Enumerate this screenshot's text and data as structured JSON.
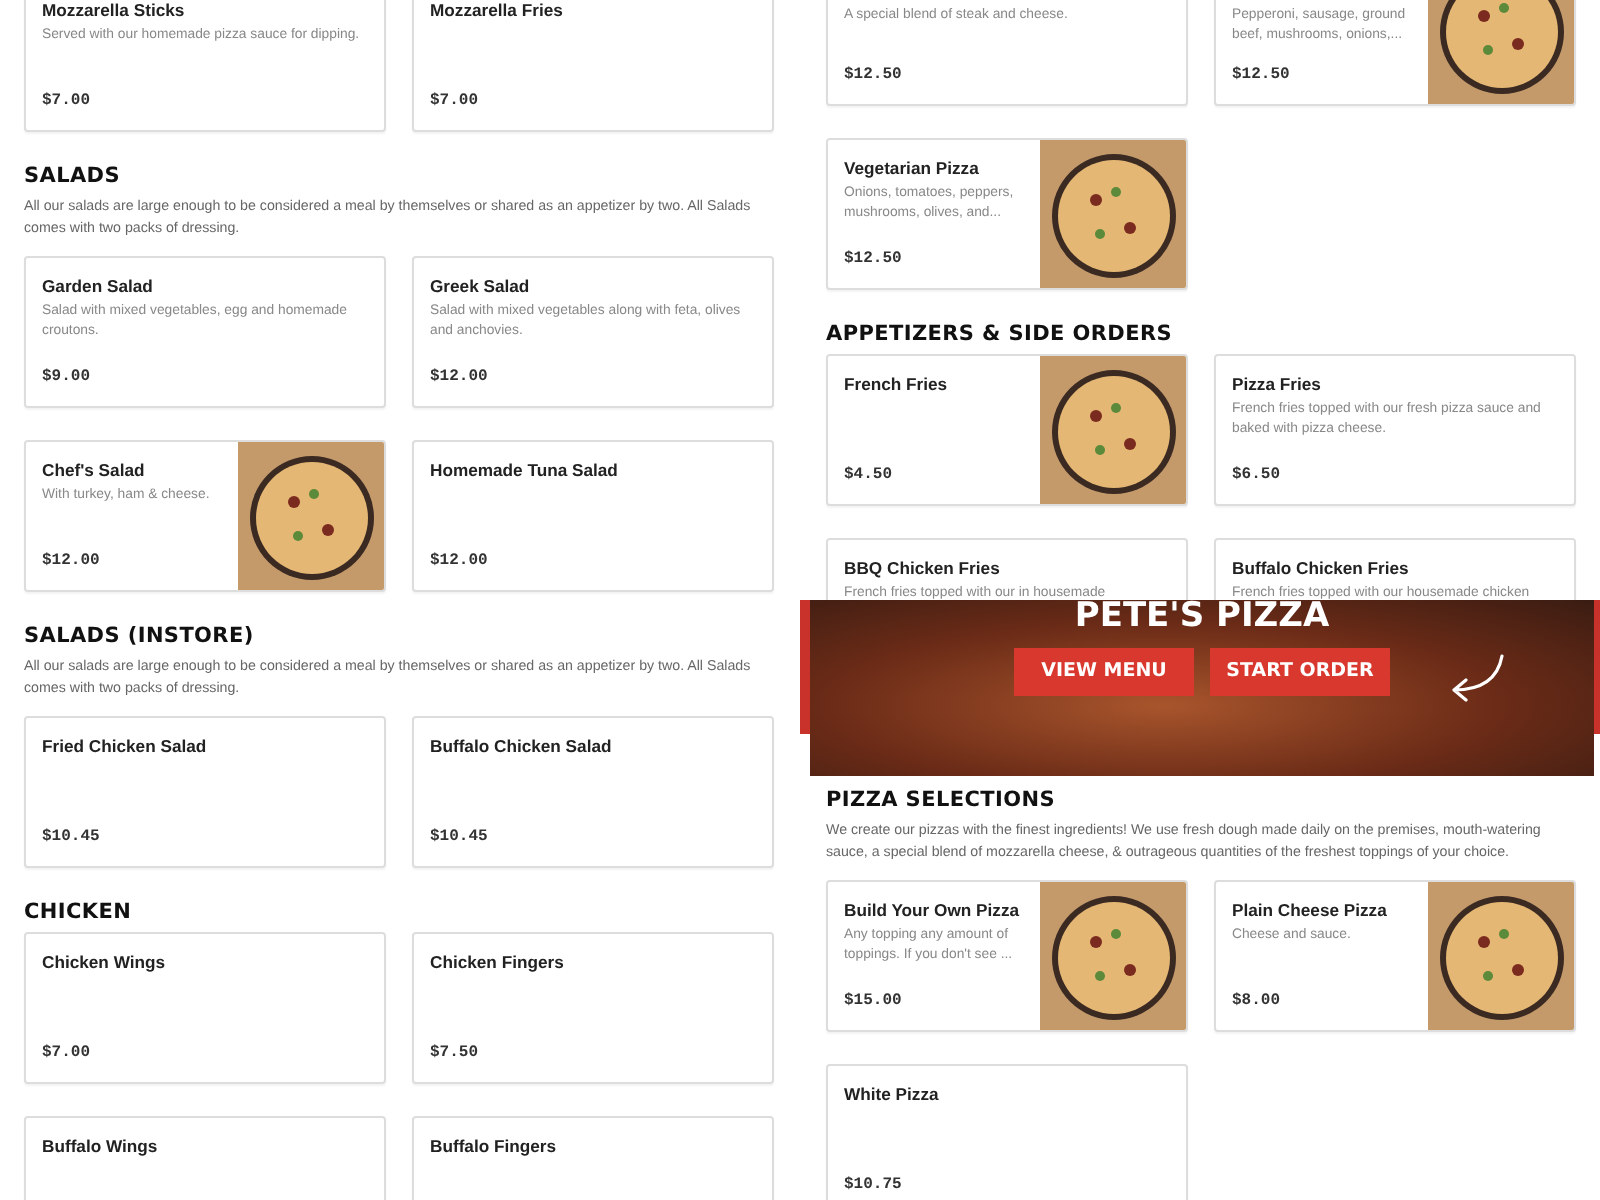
{
  "left_column": {
    "sections": [
      {
        "items": [
          {
            "name": "Mozzarella Sticks",
            "description": "Served with our homemade pizza sauce for dipping.",
            "price": "$7.00"
          },
          {
            "name": "Mozzarella Fries",
            "price": "$7.00"
          }
        ]
      },
      {
        "heading": "SALADS",
        "description": "All our salads are large enough to be considered a meal by themselves or shared as an appetizer by two. All Salads comes with two packs of dressing.",
        "items": [
          {
            "name": "Garden Salad",
            "description": "Salad with mixed vegetables, egg and homemade croutons.",
            "price": "$9.00"
          },
          {
            "name": "Greek Salad",
            "description": "Salad with mixed vegetables along with feta, olives and anchovies.",
            "price": "$12.00"
          },
          {
            "name": "Chef's Salad",
            "description": "With turkey, ham & cheese.",
            "price": "$12.00",
            "has_photo": true
          },
          {
            "name": "Homemade Tuna Salad",
            "price": "$12.00"
          }
        ]
      },
      {
        "heading": "SALADS (INSTORE)",
        "description": "All our salads are large enough to be considered a meal by themselves or shared as an appetizer by two. All Salads comes with two packs of dressing.",
        "items": [
          {
            "name": "Fried Chicken Salad",
            "price": "$10.45"
          },
          {
            "name": "Buffalo Chicken Salad",
            "price": "$10.45"
          }
        ]
      },
      {
        "heading": "CHICKEN",
        "items": [
          {
            "name": "Chicken Wings",
            "price": "$7.00"
          },
          {
            "name": "Chicken Fingers",
            "price": "$7.50"
          },
          {
            "name": "Buffalo Wings"
          },
          {
            "name": "Buffalo Fingers"
          }
        ]
      }
    ]
  },
  "right_column": {
    "top_sections": [
      {
        "items": [
          {
            "description": "A special blend of steak and cheese.",
            "price": "$12.50"
          },
          {
            "description": "Pepperoni, sausage, ground beef, mushrooms, onions,...",
            "price": "$12.50",
            "has_photo": true
          },
          {
            "name": "Vegetarian Pizza",
            "description": "Onions, tomatoes, peppers, mushrooms, olives, and...",
            "price": "$12.50",
            "has_photo": true
          }
        ]
      },
      {
        "heading": "APPETIZERS & SIDE ORDERS",
        "items": [
          {
            "name": "French Fries",
            "price": "$4.50",
            "has_photo": true
          },
          {
            "name": "Pizza Fries",
            "description": "French fries topped with our fresh pizza sauce and baked with pizza cheese.",
            "price": "$6.50"
          },
          {
            "name": "BBQ Chicken Fries",
            "description": "French fries topped with our in housemade"
          },
          {
            "name": "Buffalo Chicken Fries",
            "description": "French fries topped with our housemade chicken"
          }
        ]
      }
    ],
    "banner": {
      "title": "PETE'S PIZZA",
      "buttons": [
        "VIEW MENU",
        "START ORDER"
      ]
    },
    "bottom_sections": [
      {
        "heading": "PIZZA SELECTIONS",
        "description": "We create our pizzas with the finest ingredients! We use fresh dough made daily on the premises, mouth-watering sauce, a special blend of mozzarella cheese, & outrageous quantities of the freshest toppings of your choice.",
        "items": [
          {
            "name": "Build Your Own Pizza",
            "description": "Any topping any amount of toppings. If you don't see ...",
            "price": "$15.00",
            "has_photo": true
          },
          {
            "name": "Plain Cheese Pizza",
            "description": "Cheese and sauce.",
            "price": "$8.00",
            "has_photo": true
          },
          {
            "name": "White Pizza",
            "price": "$10.75"
          }
        ]
      }
    ]
  }
}
